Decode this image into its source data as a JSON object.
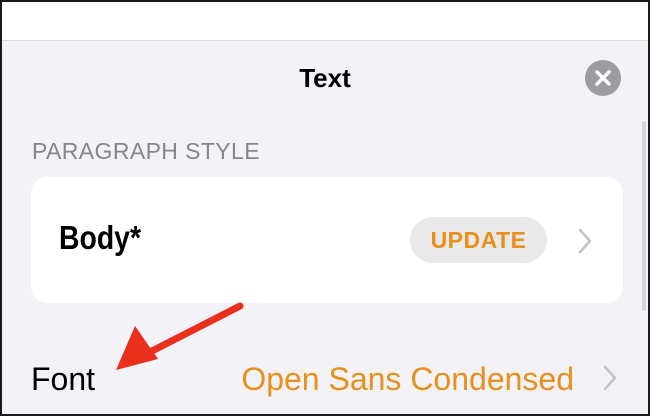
{
  "panel": {
    "title": "Text",
    "close_icon": "close-icon"
  },
  "paragraph_style": {
    "section_header": "PARAGRAPH STYLE",
    "style_name": "Body*",
    "update_label": "UPDATE",
    "chevron_icon": "chevron-right-icon"
  },
  "font_row": {
    "label": "Font",
    "value": "Open Sans Condensed",
    "chevron_icon": "chevron-right-icon"
  },
  "colors": {
    "accent": "#e8901c",
    "annotation_arrow": "#e8301c",
    "panel_background": "#f2f2f7",
    "section_header_text": "#85858b"
  }
}
